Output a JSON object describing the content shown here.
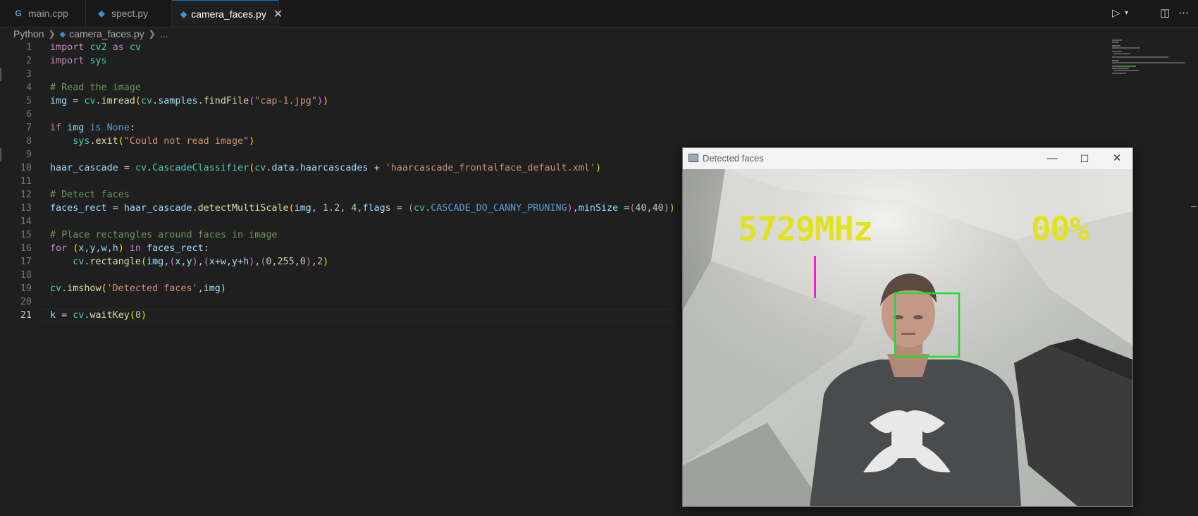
{
  "tabs": [
    {
      "label": "main.cpp",
      "icon": "c-plus-plus-icon",
      "active": false
    },
    {
      "label": "spect.py",
      "icon": "python-icon",
      "active": false
    },
    {
      "label": "camera_faces.py",
      "icon": "python-icon",
      "active": true
    }
  ],
  "breadcrumb": {
    "root": "Python",
    "file": "camera_faces.py",
    "more": "..."
  },
  "editor": {
    "line_numbers": [
      "1",
      "2",
      "3",
      "4",
      "5",
      "6",
      "7",
      "8",
      "9",
      "10",
      "11",
      "12",
      "13",
      "14",
      "15",
      "16",
      "17",
      "18",
      "19",
      "20",
      "21"
    ],
    "current_line": 21
  },
  "cv_window": {
    "title": "Detected faces",
    "overlay_freq": "5729MHz",
    "overlay_percent": "00%",
    "colors": {
      "overlay_text": "#e2e21e",
      "face_box": "#22dd22",
      "marker": "#ee22dd"
    }
  }
}
